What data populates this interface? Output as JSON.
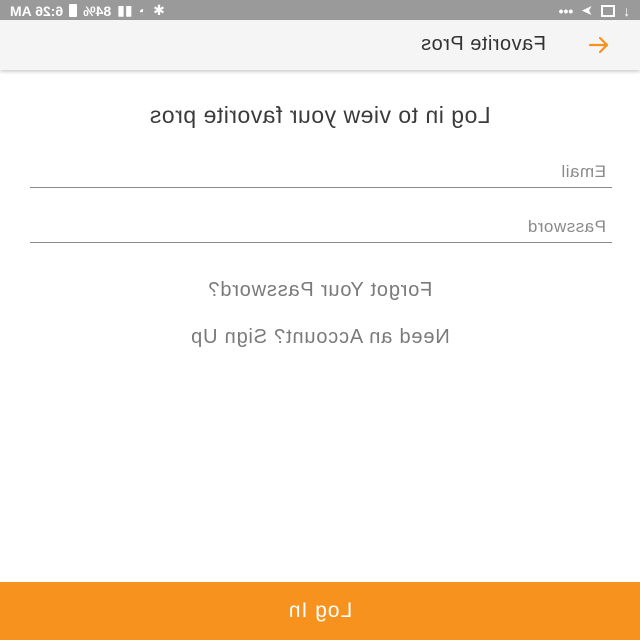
{
  "status_bar": {
    "time": "6:26 AM",
    "battery": "84%",
    "notification_dots": "•••"
  },
  "app_bar": {
    "title": "Favorite Pros",
    "back_icon": "arrow-left-icon",
    "accent_color": "#f7921e"
  },
  "main": {
    "heading": "Log in to view your favorite pros",
    "email_placeholder": "Email",
    "password_placeholder": "Password",
    "forgot_password_label": "Forgot Your Password?",
    "sign_up_label": "Need an Account? Sign Up"
  },
  "footer": {
    "login_label": "Log In",
    "button_color": "#f7921e"
  }
}
